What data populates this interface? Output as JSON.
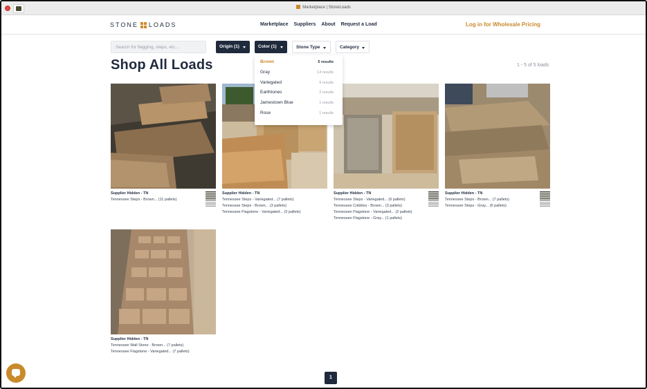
{
  "browser": {
    "tab_title": "Marketplace | StoneLoads"
  },
  "header": {
    "logo_left": "STONE",
    "logo_right": "LOADS",
    "nav": [
      "Marketplace",
      "Suppliers",
      "About",
      "Request a Load"
    ],
    "login": "Log in for Wholesale Pricing"
  },
  "filters": {
    "search_placeholder": "Search for flagging, steps, etc...",
    "origin": "Origin (1)",
    "color": "Color (1)",
    "stone_type": "Stone Type",
    "category": "Category"
  },
  "page": {
    "title": "Shop All Loads",
    "results": "1 - 5 of 5 loads"
  },
  "color_dropdown": {
    "items": [
      {
        "name": "Brown",
        "count": "5 results",
        "selected": true
      },
      {
        "name": "Gray",
        "count": "14 results",
        "selected": false
      },
      {
        "name": "Variegated",
        "count": "9 results",
        "selected": false
      },
      {
        "name": "Earthtones",
        "count": "2 results",
        "selected": false
      },
      {
        "name": "Jamestown Blue",
        "count": "1 results",
        "selected": false
      },
      {
        "name": "Rose",
        "count": "1 results",
        "selected": false
      }
    ]
  },
  "cards": [
    {
      "supplier": "Supplier Hidden - TN",
      "lines": [
        "Tennessee Steps - Brown... (11 pallets)"
      ]
    },
    {
      "supplier": "Supplier Hidden - TN",
      "lines": [
        "Tennessee Steps - Variegated... (7 pallets)",
        "Tennessee Steps - Brown... (3 pallets)",
        "Tennessee Flagstone - Variegated... (3 pallets)"
      ]
    },
    {
      "supplier": "Supplier Hidden - TN",
      "lines": [
        "Tennessee Steps - Variegated... (6 pallets)",
        "Tennessee Cobbles - Brown... (3 pallets)",
        "Tennessee Flagstone - Variegated... (2 pallets)",
        "Tennessee Flagstone - Gray... (1 pallets)"
      ]
    },
    {
      "supplier": "Supplier Hidden - TN",
      "lines": [
        "Tennessee Steps - Brown... (7 pallets)",
        "Tennessee Steps - Gray... (6 pallets)"
      ]
    },
    {
      "supplier": "Supplier Hidden - TN",
      "lines": [
        "Tennessee Wall Stone - Brown... (7 pallets)",
        "Tennessee Flagstone - Variegated... (7 pallets)"
      ]
    }
  ],
  "pagination": {
    "current": "1"
  },
  "icons": {
    "chat": "chat-bubble-icon",
    "caret": "caret-down-icon"
  },
  "colors": {
    "navy": "#1f2a3d",
    "accent": "#c98a2c"
  }
}
